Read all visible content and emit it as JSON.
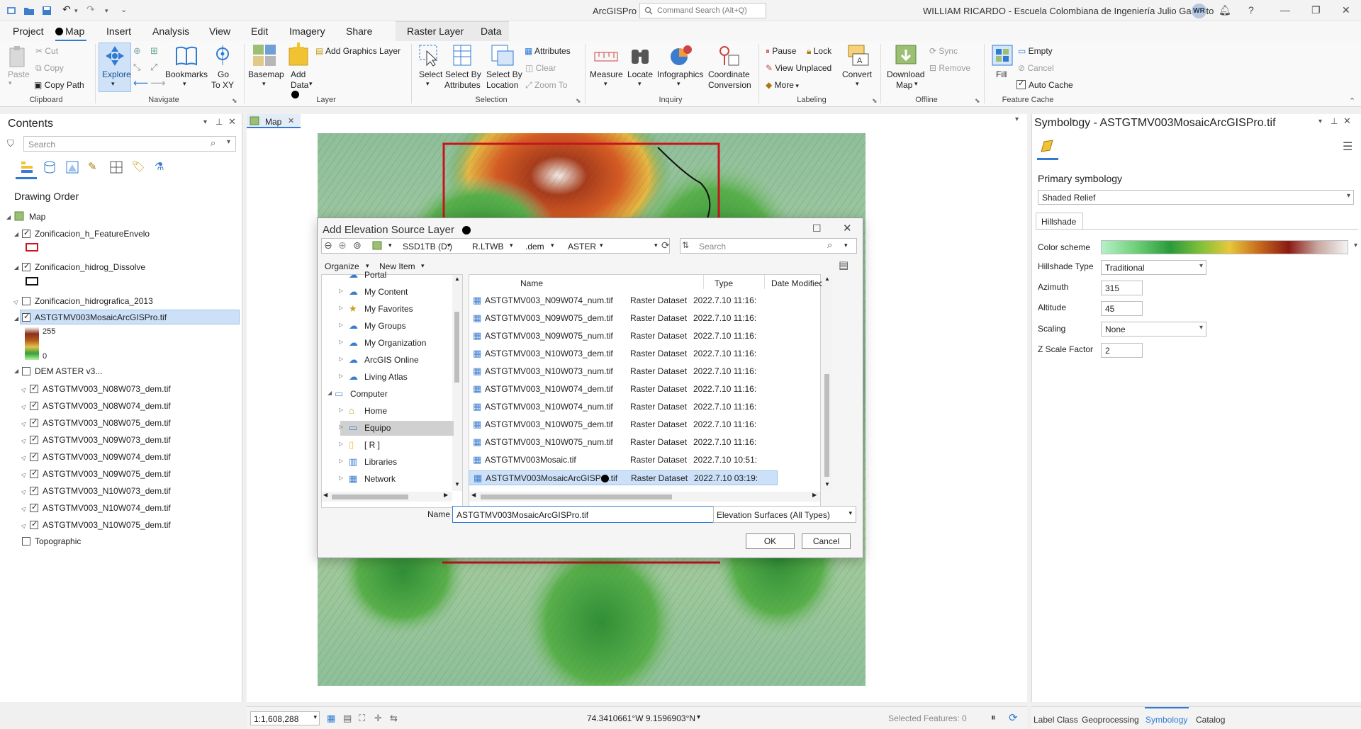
{
  "app": {
    "title": "ArcGISPro",
    "search_placeholder": "Command Search (Alt+Q)",
    "user": "WILLIAM RICARDO  - Escuela Colombiana de Ingeniería Julio Garavito",
    "avatar": "WR"
  },
  "tabs": [
    "Project",
    "Map",
    "Insert",
    "Analysis",
    "View",
    "Edit",
    "Imagery",
    "Share",
    "Raster Layer",
    "Data"
  ],
  "ribbon": {
    "clipboard": {
      "paste": "Paste",
      "cut": "Cut",
      "copy": "Copy",
      "copy_path": "Copy Path",
      "group": "Clipboard"
    },
    "navigate": {
      "explore": "Explore",
      "bookmarks": "Bookmarks",
      "goto": "Go\nTo XY",
      "goto_a": "Go",
      "goto_b": "To XY",
      "group": "Navigate"
    },
    "layer": {
      "basemap": "Basemap",
      "add_data_a": "Add",
      "add_data_b": "Data",
      "add_graphics": "Add Graphics Layer",
      "group": "Layer"
    },
    "selection": {
      "select": "Select",
      "by_attr_a": "Select By",
      "by_attr_b": "Attributes",
      "by_loc_a": "Select By",
      "by_loc_b": "Location",
      "attributes": "Attributes",
      "clear": "Clear",
      "zoom_to": "Zoom To",
      "group": "Selection"
    },
    "inquiry": {
      "measure": "Measure",
      "locate": "Locate",
      "infographics": "Infographics",
      "coord_a": "Coordinate",
      "coord_b": "Conversion",
      "group": "Inquiry"
    },
    "labeling": {
      "pause": "Pause",
      "lock": "Lock",
      "view_unplaced": "View Unplaced",
      "more": "More",
      "convert": "Convert",
      "group": "Labeling"
    },
    "offline": {
      "download_a": "Download",
      "download_b": "Map",
      "sync": "Sync",
      "remove": "Remove",
      "group": "Offline"
    },
    "feature_cache": {
      "fill": "Fill",
      "empty": "Empty",
      "cancel": "Cancel",
      "auto_cache": "Auto Cache",
      "group": "Feature Cache"
    }
  },
  "contents": {
    "title": "Contents",
    "search_placeholder": "Search",
    "drawing_order": "Drawing Order",
    "map_label": "Map",
    "layers": [
      {
        "name": "Zonificacion_h_FeatureEnvelo"
      },
      {
        "name": "Zonificacion_hidrog_Dissolve"
      },
      {
        "name": "Zonificacion_hidrografica_2013"
      },
      {
        "name": "ASTGTMV003MosaicArcGISPro.tif"
      },
      {
        "name": "DEM ASTER v3..."
      },
      {
        "name": "ASTGTMV003_N08W073_dem.tif"
      },
      {
        "name": "ASTGTMV003_N08W074_dem.tif"
      },
      {
        "name": "ASTGTMV003_N08W075_dem.tif"
      },
      {
        "name": "ASTGTMV003_N09W073_dem.tif"
      },
      {
        "name": "ASTGTMV003_N09W074_dem.tif"
      },
      {
        "name": "ASTGTMV003_N09W075_dem.tif"
      },
      {
        "name": "ASTGTMV003_N10W073_dem.tif"
      },
      {
        "name": "ASTGTMV003_N10W074_dem.tif"
      },
      {
        "name": "ASTGTMV003_N10W075_dem.tif"
      },
      {
        "name": "Topographic"
      }
    ],
    "legend_high": "255",
    "legend_low": "0"
  },
  "map_tab": "Map",
  "dialog": {
    "title": "Add Elevation Source Layer",
    "path": [
      "SSD1TB (D:)",
      "R.LTWB",
      ".dem",
      "ASTER"
    ],
    "search_placeholder": "Search",
    "organize": "Organize",
    "new_item": "New Item",
    "tree": [
      "Portal",
      "My Content",
      "My Favorites",
      "My Groups",
      "My Organization",
      "ArcGIS Online",
      "Living Atlas",
      "Computer",
      "Home",
      "Equipo",
      "[ R ]",
      "Libraries",
      "Network"
    ],
    "columns": [
      "Name",
      "Type",
      "Date Modified"
    ],
    "files": [
      {
        "name": "ASTGTMV003_N09W074_num.tif",
        "type": "Raster Dataset",
        "date": "2022.7.10 11:16:"
      },
      {
        "name": "ASTGTMV003_N09W075_dem.tif",
        "type": "Raster Dataset",
        "date": "2022.7.10 11:16:"
      },
      {
        "name": "ASTGTMV003_N09W075_num.tif",
        "type": "Raster Dataset",
        "date": "2022.7.10 11:16:"
      },
      {
        "name": "ASTGTMV003_N10W073_dem.tif",
        "type": "Raster Dataset",
        "date": "2022.7.10 11:16:"
      },
      {
        "name": "ASTGTMV003_N10W073_num.tif",
        "type": "Raster Dataset",
        "date": "2022.7.10 11:16:"
      },
      {
        "name": "ASTGTMV003_N10W074_dem.tif",
        "type": "Raster Dataset",
        "date": "2022.7.10 11:16:"
      },
      {
        "name": "ASTGTMV003_N10W074_num.tif",
        "type": "Raster Dataset",
        "date": "2022.7.10 11:16:"
      },
      {
        "name": "ASTGTMV003_N10W075_dem.tif",
        "type": "Raster Dataset",
        "date": "2022.7.10 11:16:"
      },
      {
        "name": "ASTGTMV003_N10W075_num.tif",
        "type": "Raster Dataset",
        "date": "2022.7.10 11:16:"
      },
      {
        "name": "ASTGTMV003Mosaic.tif",
        "type": "Raster Dataset",
        "date": "2022.7.10 10:51:"
      },
      {
        "name": "ASTGTMV003MosaicArcGISPro.tif",
        "type": "Raster Dataset",
        "date": "2022.7.10 03:19:"
      }
    ],
    "name_label": "Name",
    "name_value": "ASTGTMV003MosaicArcGISPro.tif",
    "filter": "Elevation Surfaces (All Types)",
    "ok": "OK",
    "cancel": "Cancel"
  },
  "symbology": {
    "title": "Symbology - ASTGTMV003MosaicArcGISPro.tif",
    "primary": "Primary symbology",
    "method": "Shaded Relief",
    "tab": "Hillshade",
    "color_scheme": "Color scheme",
    "hillshade_type_label": "Hillshade Type",
    "hillshade_type": "Traditional",
    "azimuth_label": "Azimuth",
    "azimuth": "315",
    "altitude_label": "Altitude",
    "altitude": "45",
    "scaling_label": "Scaling",
    "scaling": "None",
    "zscale_label": "Z Scale Factor",
    "zscale": "2"
  },
  "status": {
    "scale": "1:1,608,288",
    "coords": "74.3410661°W 9.1596903°N",
    "selected": "Selected Features: 0"
  },
  "bottom_tabs": [
    "Label Class",
    "Geoprocessing",
    "Symbology",
    "Catalog"
  ],
  "colors": {
    "accent": "#2f7bd3",
    "selected_row": "#cce0f7",
    "map_frame": "#c8141e"
  }
}
